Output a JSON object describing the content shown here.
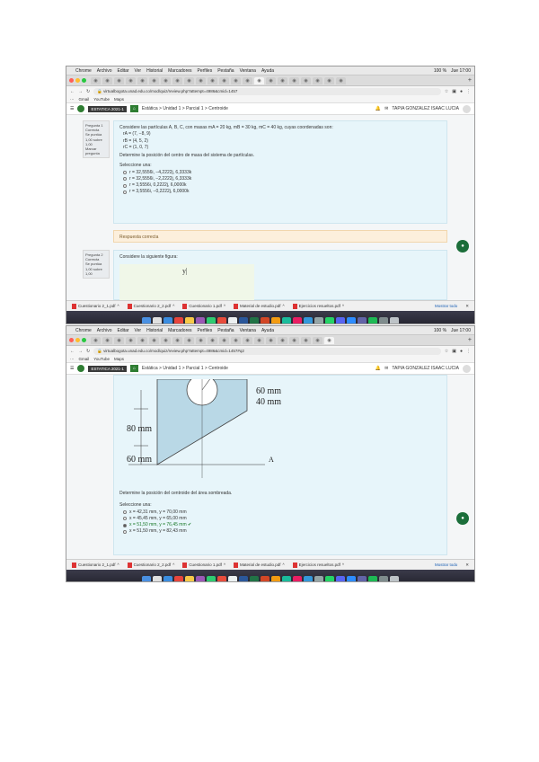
{
  "menubar": {
    "items": [
      "Chrome",
      "Archivo",
      "Editar",
      "Ver",
      "Historial",
      "Marcadores",
      "Perfiles",
      "Pestaña",
      "Ventana",
      "Ayuda"
    ],
    "right": [
      "100 %",
      "Jue 17:00"
    ]
  },
  "browser": {
    "url1": "virtualbogota.unad.edu.co/mod/quiz/review.php?attempt=4986&cmid=1457",
    "url2": "virtualbogota.unad.edu.co/mod/quiz/review.php?attempt=4986&cmid=1457#q2",
    "bookmarks": [
      "Gmail",
      "YouTube",
      "Maps"
    ]
  },
  "moodle": {
    "course": "ESTATICA 2021-1",
    "breadcrumb": "Estática > Unidad 1 > Parcial 1 > Centroide",
    "user": "TAPIA GONZALEZ ISAAC LUCIA"
  },
  "q1": {
    "info": [
      "Pregunta 1",
      "Correcta",
      "Se puntúa 1,00 sobre 1,00",
      "Marcar pregunta"
    ],
    "text": "Considere las partículas A, B, C, con masas mA = 20 kg, mB = 30 kg, mC = 40 kg, cuyas coordenadas son:",
    "coords": [
      "rA = (7, −8, 9)",
      "rB = (4, 5, 2)",
      "rC = (1, 0, 7)"
    ],
    "instruction": "Determine la posición del centro de masa del sistema de partículas.",
    "select_label": "Seleccione una:",
    "answers": [
      "r = 32,5556i, −4,2222j, 6,3333k",
      "r = 32,5556i, −2,2222j, 6,3333k",
      "r = 3,5556i, 0,2222j, 6,0000k",
      "r = 3,5556i, −0,2222j, 6,0000k"
    ],
    "feedback": "Respuesta correcta"
  },
  "q2": {
    "info": [
      "Pregunta 2",
      "Correcta",
      "Se puntúa 1,00 sobre 1,00"
    ],
    "text": "Considere la siguiente figura:",
    "fig": {
      "a": "60 mm",
      "b": "40 mm",
      "c": "80 mm",
      "d": "60 mm",
      "axis": "A"
    },
    "instruction": "Determine la posición del centroide del área sombreada.",
    "select_label": "Seleccione una:",
    "answers": [
      "x = 42,31 mm, y = 70,00 mm",
      "x = 45,45 mm, y = 65,00 mm",
      "x = 51,50 mm, y = 76,45 mm ✔",
      "x = 51,50 mm, y = 82,43 mm"
    ]
  },
  "downloads": {
    "files": [
      "Cuestionario 2_1.pdf",
      "Cuestionario 2_2.pdf",
      "Cuestionario 1.pdf",
      "Material de estudio.pdf",
      "Ejercicios resueltos.pdf"
    ],
    "show_all": "Mostrar todo"
  }
}
